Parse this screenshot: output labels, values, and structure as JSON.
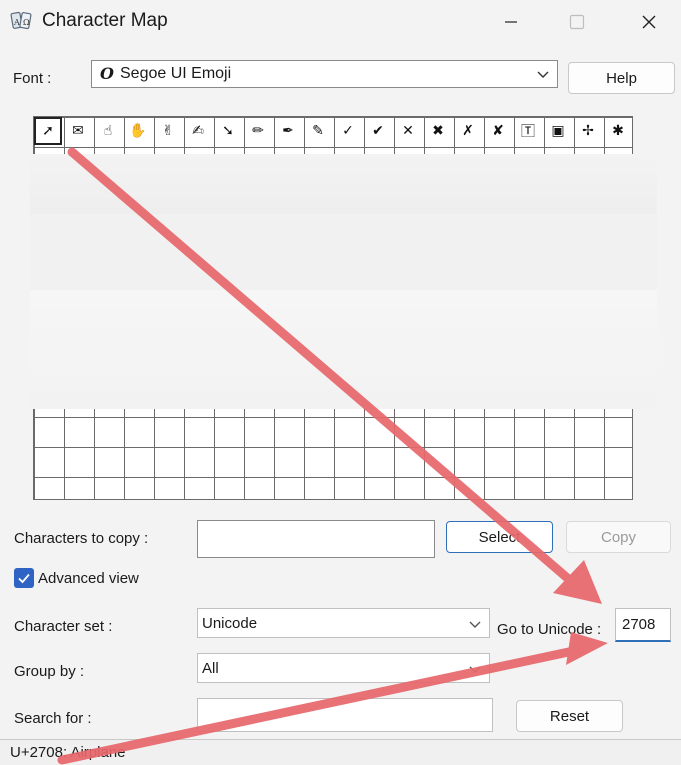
{
  "window": {
    "title": "Character Map"
  },
  "font": {
    "label": "Font :",
    "value": "Segoe UI Emoji",
    "glyph": "O"
  },
  "help_label": "Help",
  "grid": {
    "row1": [
      "➚",
      "✉",
      "☝",
      "✋",
      "✌",
      "✍",
      "➘",
      "✏",
      "✒",
      "✎",
      "✓",
      "✔",
      "✕",
      "✖",
      "✗",
      "✘",
      "🅃",
      "▣",
      "✢",
      "✱"
    ],
    "selected_index": 0
  },
  "copy": {
    "label": "Characters to copy :",
    "value": "",
    "select_label": "Select",
    "copy_label": "Copy"
  },
  "advanced": {
    "label": "Advanced view",
    "checked": true
  },
  "charset": {
    "label": "Character set :",
    "value": "Unicode"
  },
  "goto": {
    "label": "Go to Unicode :",
    "value": "2708"
  },
  "groupby": {
    "label": "Group by :",
    "value": "All"
  },
  "search": {
    "label": "Search for :",
    "value": ""
  },
  "reset_label": "Reset",
  "status": "U+2708: Airplane",
  "colors": {
    "annotation_arrow": "#e8676b",
    "accent": "#2f63c4"
  },
  "icons": {
    "app": "character-map-icon",
    "minimize": "minimize-icon",
    "maximize": "maximize-icon",
    "close": "close-icon"
  }
}
